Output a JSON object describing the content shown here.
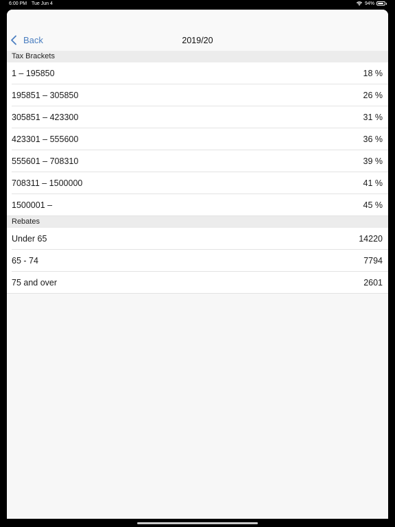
{
  "status_bar": {
    "time": "6:00 PM",
    "date": "Tue Jun 4",
    "battery_percent": "94%",
    "battery_level": 0.94,
    "wifi_icon": "wifi-icon",
    "battery_icon": "battery-icon"
  },
  "nav": {
    "back_label": "Back",
    "back_icon": "chevron-left-icon",
    "title": "2019/20",
    "accent_color": "#4a7ec0"
  },
  "tax_brackets": {
    "header": "Tax Brackets",
    "rows": [
      {
        "range": "1 – 195850",
        "rate": "18 %"
      },
      {
        "range": "195851 – 305850",
        "rate": "26 %"
      },
      {
        "range": "305851 – 423300",
        "rate": "31 %"
      },
      {
        "range": "423301 – 555600",
        "rate": "36 %"
      },
      {
        "range": "555601 – 708310",
        "rate": "39 %"
      },
      {
        "range": "708311 – 1500000",
        "rate": "41 %"
      },
      {
        "range": "1500001 –",
        "rate": "45 %"
      }
    ]
  },
  "rebates": {
    "header": "Rebates",
    "rows": [
      {
        "label": "Under 65",
        "value": "14220"
      },
      {
        "label": "65 - 74",
        "value": "7794"
      },
      {
        "label": "75 and over",
        "value": "2601"
      }
    ]
  }
}
